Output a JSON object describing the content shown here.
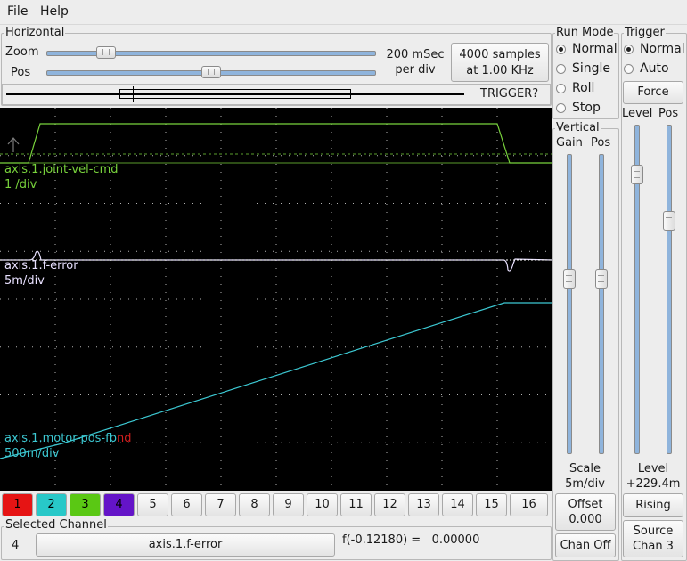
{
  "menu": {
    "file": "File",
    "help": "Help"
  },
  "horizontal": {
    "title": "Horizontal",
    "zoom_label": "Zoom",
    "pos_label": "Pos",
    "time_per_div_line1": "200 mSec",
    "time_per_div_line2": "per div",
    "samples_line1": "4000 samples",
    "samples_line2": "at 1.00 KHz",
    "trigger_status": "TRIGGER?",
    "zoom_level": 0.16,
    "pos_level": 0.5
  },
  "run_mode": {
    "title": "Run Mode",
    "options": [
      "Normal",
      "Single",
      "Roll",
      "Stop"
    ],
    "selected": "Normal"
  },
  "trigger": {
    "title": "Trigger",
    "options": [
      "Normal",
      "Auto"
    ],
    "selected": "Normal",
    "force_label": "Force",
    "level_label": "Level",
    "pos_label": "Pos",
    "level_caption": "Level",
    "level_value": "+229.4m",
    "edge_button": "Rising",
    "source_line1": "Source",
    "source_line2": "Chan  3",
    "level_fraction": 0.13,
    "pos_fraction": 0.28
  },
  "vertical": {
    "title": "Vertical",
    "gain_label": "Gain",
    "pos_label": "Pos",
    "scale_label": "Scale",
    "scale_value": "5m/div",
    "offset_line1": "Offset",
    "offset_line2": "0.000",
    "chan_off_label": "Chan Off",
    "gain_fraction": 0.41,
    "pos_fraction": 0.41
  },
  "traces": [
    {
      "name": "axis.1.joint-vel-cmd",
      "scale": "1 /div",
      "color": "#78d23c"
    },
    {
      "name": "axis.1.f-error",
      "scale": "5m/div",
      "color": "#e8e0ff"
    },
    {
      "name": "axis.1.motor-pos-fb",
      "name_suffix": "nd",
      "scale": "500m/div",
      "color": "#3cc8d2",
      "suffix_color": "#d21e1e"
    }
  ],
  "channels": [
    {
      "label": "1",
      "color": "#e61414",
      "active": true
    },
    {
      "label": "2",
      "color": "#28c8c8",
      "active": true
    },
    {
      "label": "3",
      "color": "#5ac814",
      "active": true
    },
    {
      "label": "4",
      "color": "#6414c8",
      "active": true
    },
    {
      "label": "5"
    },
    {
      "label": "6"
    },
    {
      "label": "7"
    },
    {
      "label": "8"
    },
    {
      "label": "9"
    },
    {
      "label": "10"
    },
    {
      "label": "11"
    },
    {
      "label": "12"
    },
    {
      "label": "13"
    },
    {
      "label": "14"
    },
    {
      "label": "15"
    },
    {
      "label": "16"
    }
  ],
  "selected_channel": {
    "title": "Selected Channel",
    "number": "4",
    "signal": "axis.1.f-error",
    "readout": "f(-0.12180) =   0.00000"
  }
}
